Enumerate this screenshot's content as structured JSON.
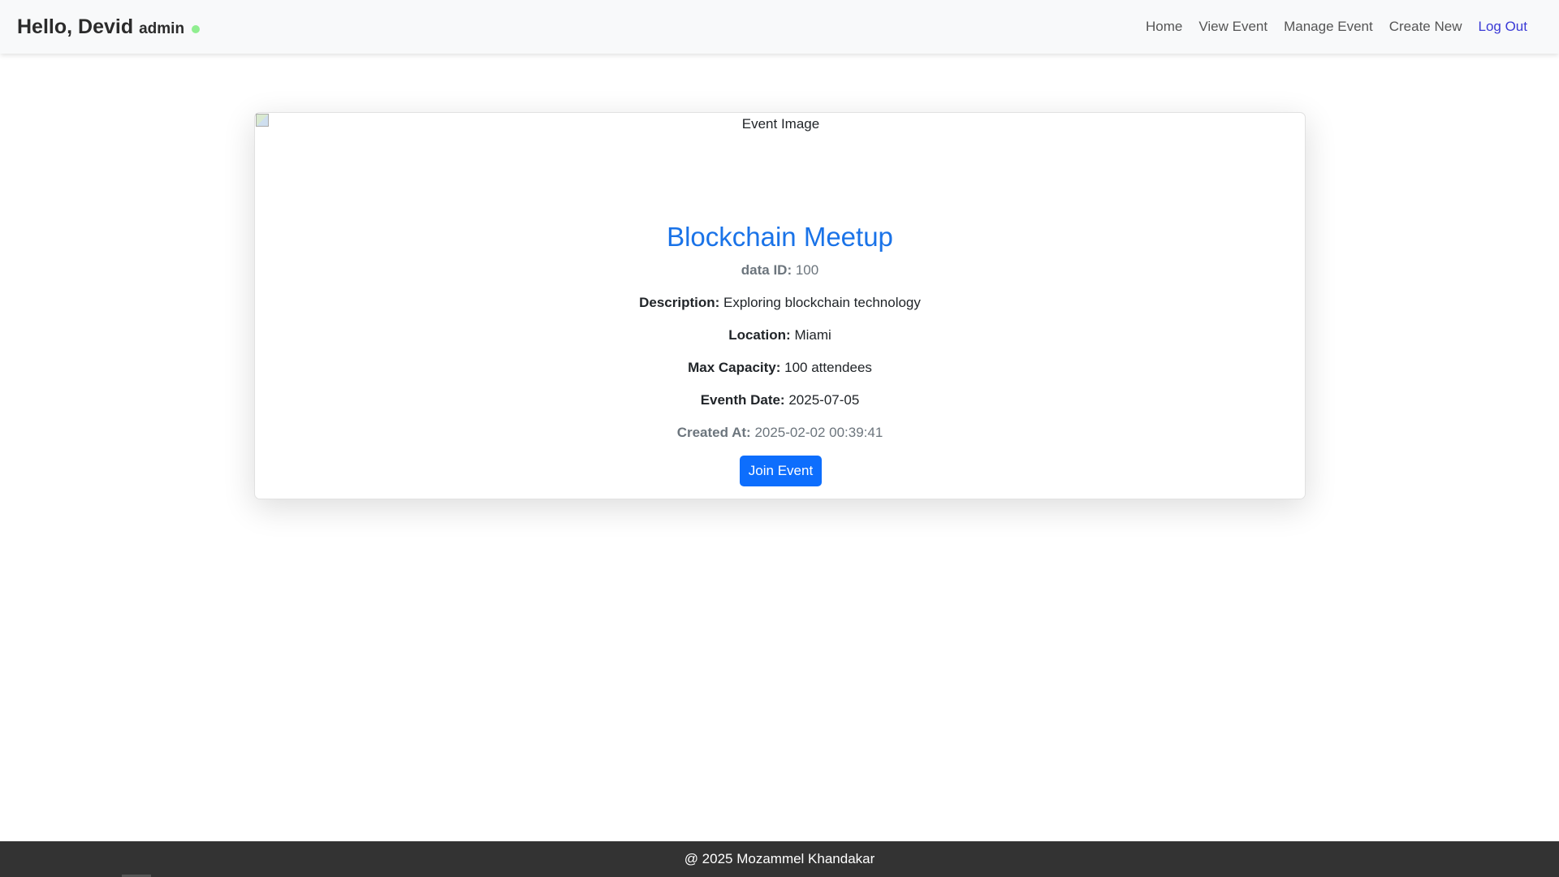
{
  "header": {
    "greeting": "Hello, Devid",
    "role": "admin",
    "status_color": "#90ee90",
    "nav": [
      {
        "label": "Home"
      },
      {
        "label": "View Event"
      },
      {
        "label": "Manage Event"
      },
      {
        "label": "Create New"
      },
      {
        "label": "Log Out"
      }
    ]
  },
  "event": {
    "image_alt": "Event Image",
    "title": "Blockchain Meetup",
    "id_label": "data ID:",
    "id_value": "100",
    "description_label": "Description:",
    "description_value": "Exploring blockchain technology",
    "location_label": "Location:",
    "location_value": "Miami",
    "capacity_label": "Max Capacity:",
    "capacity_value": "100 attendees",
    "date_label": "Eventh Date:",
    "date_value": "2025-07-05",
    "created_label": "Created At:",
    "created_value": "2025-02-02 00:39:41",
    "join_label": "Join Event",
    "title_color": "#1a73e8",
    "button_color": "#0d6efd"
  },
  "footer": {
    "text": "@ 2025 Mozammel Khandakar"
  }
}
